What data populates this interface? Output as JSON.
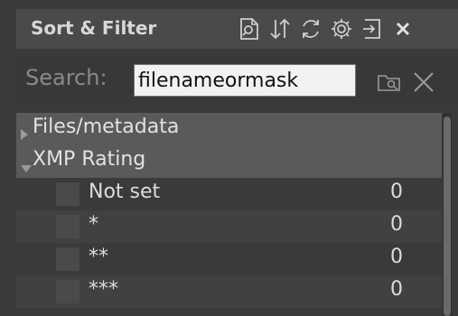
{
  "panel": {
    "title": "Sort & Filter",
    "header_icons": [
      "document-search-icon",
      "sort-icon",
      "refresh-icon",
      "settings-icon",
      "dock-icon",
      "close-icon"
    ]
  },
  "search": {
    "label": "Search:",
    "value": "filenameormask",
    "icons": [
      "folder-search-icon",
      "clear-icon"
    ]
  },
  "tree": {
    "groups": [
      {
        "label": "Files/metadata",
        "expanded": false
      },
      {
        "label": "XMP Rating",
        "expanded": true
      }
    ],
    "items": [
      {
        "label": "Not set",
        "count": "0"
      },
      {
        "label": "*",
        "count": "0"
      },
      {
        "label": "**",
        "count": "0"
      },
      {
        "label": "***",
        "count": "0"
      }
    ]
  }
}
